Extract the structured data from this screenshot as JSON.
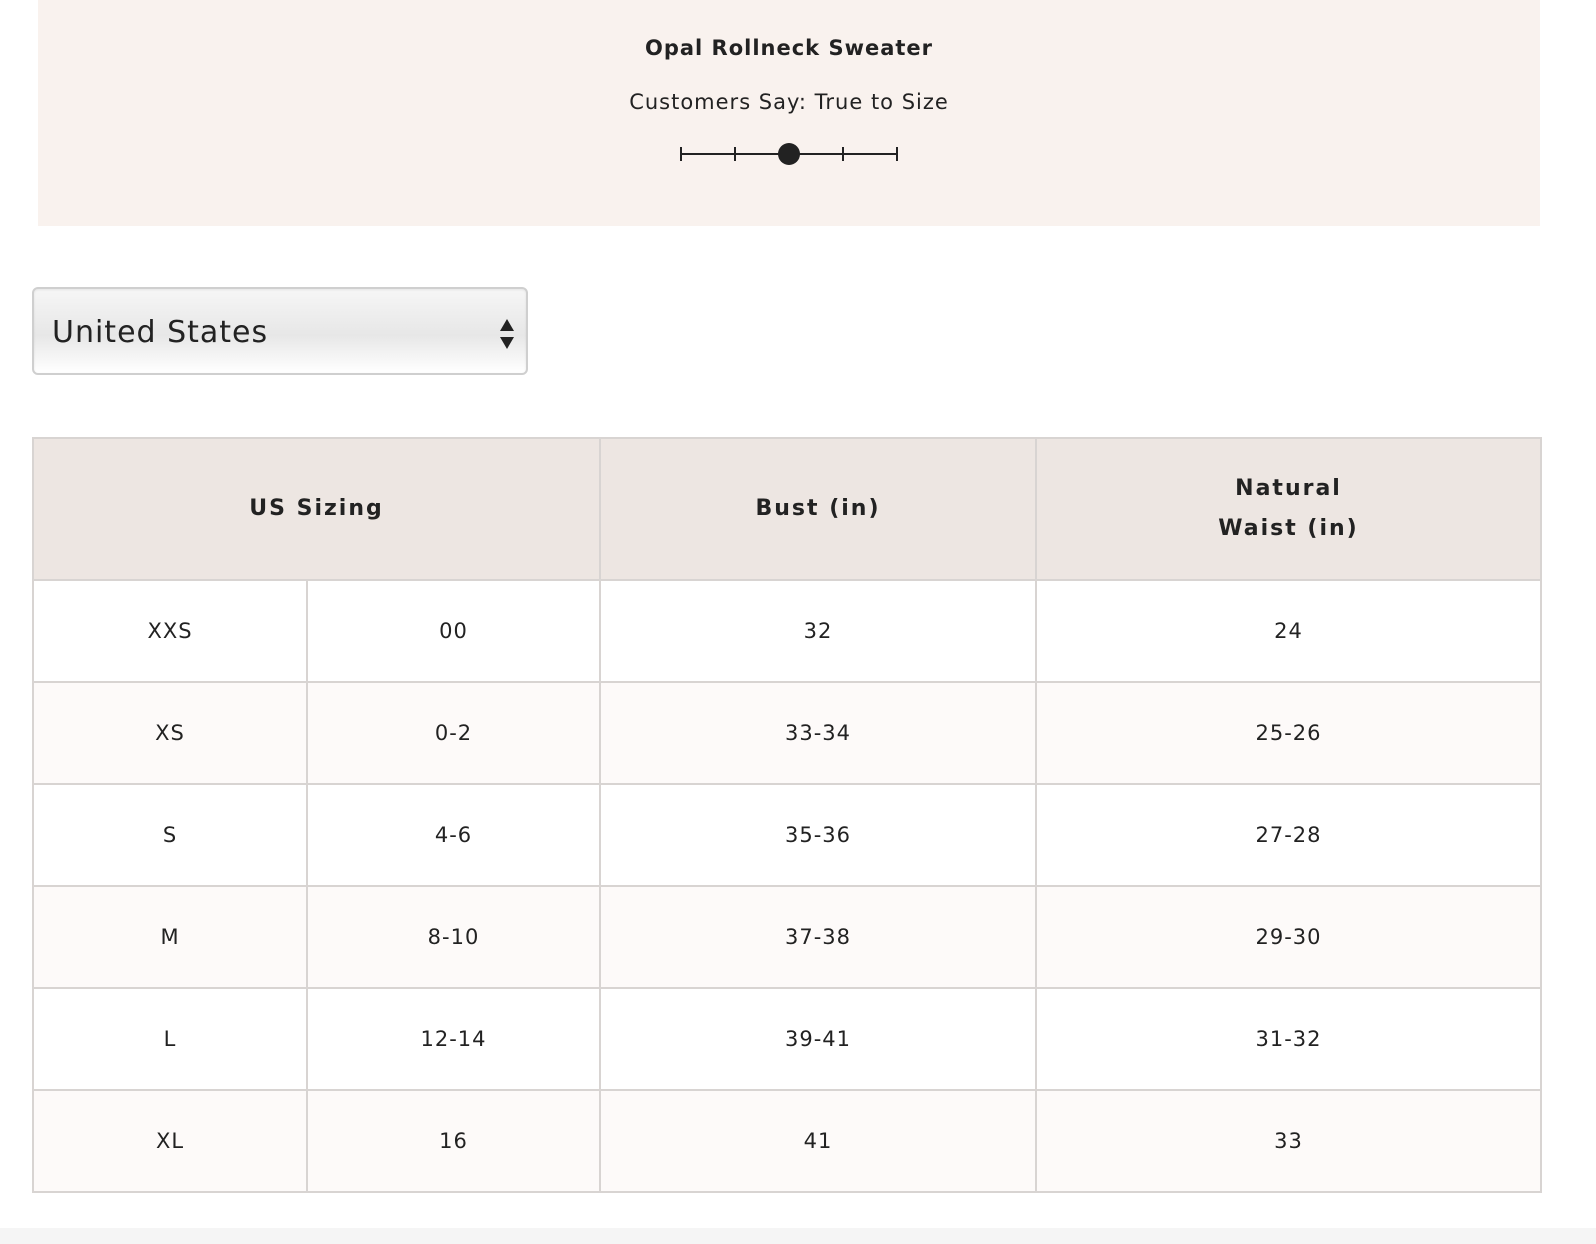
{
  "product": {
    "title": "Opal Rollneck Sweater",
    "fit_caption": "Customers Say: True to Size",
    "fit_scale": {
      "positions": 5,
      "selected_index": 2
    }
  },
  "country_select": {
    "selected": "United States",
    "icon": "updown-arrows-icon"
  },
  "size_table": {
    "headers": {
      "sizing": "US Sizing",
      "bust": "Bust (in)",
      "waist_line1": "Natural",
      "waist_line2": "Waist (in)"
    },
    "rows": [
      {
        "letter": "XXS",
        "number": "00",
        "bust": "32",
        "waist": "24"
      },
      {
        "letter": "XS",
        "number": "0-2",
        "bust": "33-34",
        "waist": "25-26"
      },
      {
        "letter": "S",
        "number": "4-6",
        "bust": "35-36",
        "waist": "27-28"
      },
      {
        "letter": "M",
        "number": "8-10",
        "bust": "37-38",
        "waist": "29-30"
      },
      {
        "letter": "L",
        "number": "12-14",
        "bust": "39-41",
        "waist": "31-32"
      },
      {
        "letter": "XL",
        "number": "16",
        "bust": "41",
        "waist": "33"
      }
    ]
  },
  "colors": {
    "panel_bg": "#f9f2ee",
    "header_bg": "#ede6e2",
    "alt_row_bg": "#fdfaf9",
    "border": "#d8d4d2",
    "text": "#222222"
  }
}
